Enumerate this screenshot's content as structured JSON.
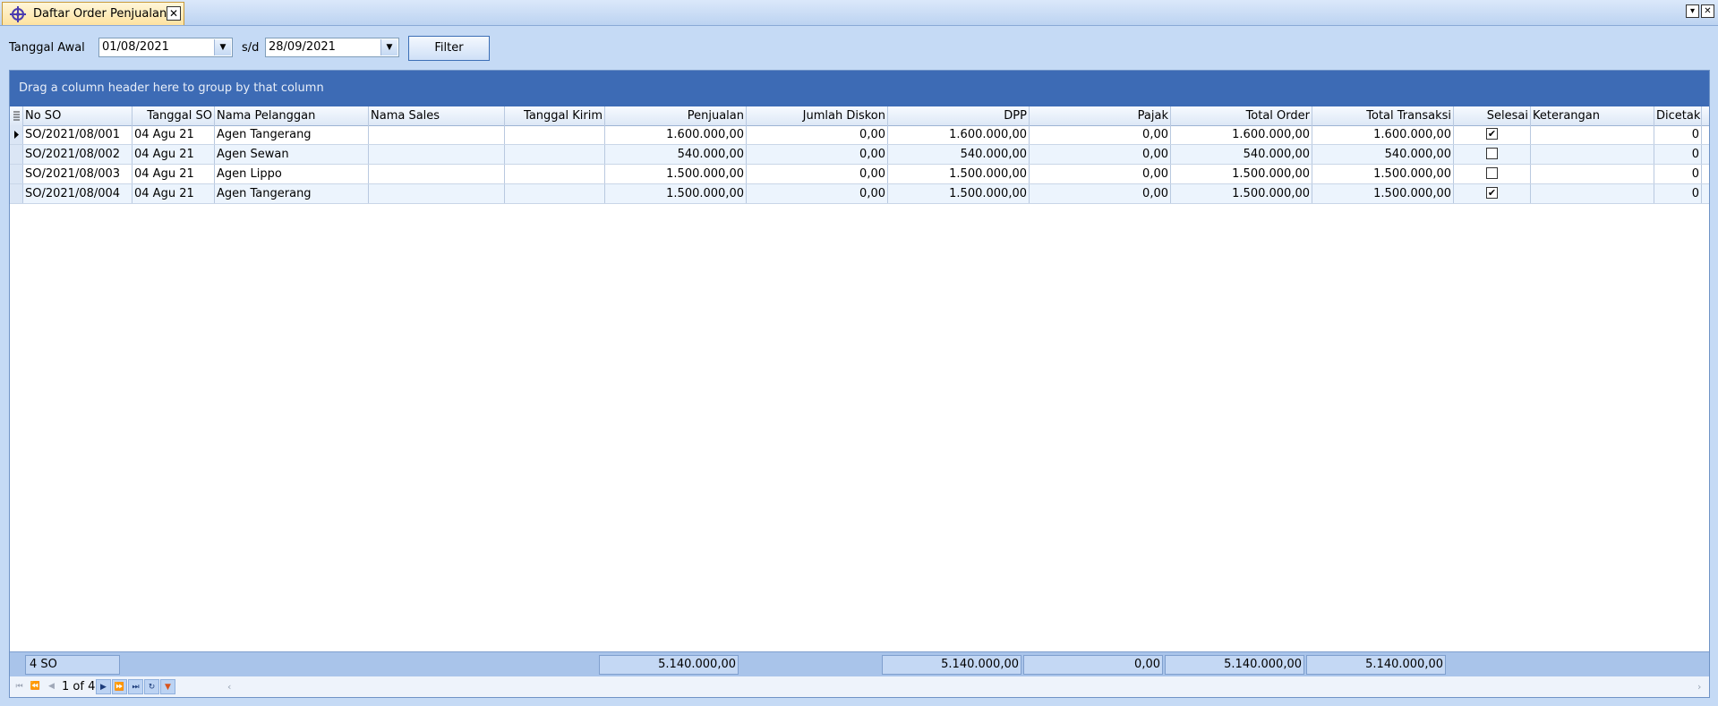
{
  "tab": {
    "title": "Daftar Order Penjualan",
    "close_glyph": "✕"
  },
  "window": {
    "menu_glyph": "▾",
    "close_glyph": "✕"
  },
  "filter": {
    "start_label": "Tanggal Awal",
    "start_value": "01/08/2021",
    "sep_label": "s/d",
    "end_value": "28/09/2021",
    "button_label": "Filter"
  },
  "grid": {
    "group_hint": "Drag a column header here to group by that column",
    "columns": [
      "No SO",
      "Tanggal SO",
      "Nama Pelanggan",
      "Nama Sales",
      "Tanggal Kirim",
      "Penjualan",
      "Jumlah Diskon",
      "DPP",
      "Pajak",
      "Total Order",
      "Total Transaksi",
      "Selesai",
      "Keterangan",
      "Dicetak"
    ],
    "rows": [
      {
        "no_so": "SO/2021/08/001",
        "tanggal": "04 Agu 21",
        "pelanggan": "Agen Tangerang",
        "sales": "",
        "kirim": "",
        "penjualan": "1.600.000,00",
        "diskon": "0,00",
        "dpp": "1.600.000,00",
        "pajak": "0,00",
        "total_order": "1.600.000,00",
        "total_transaksi": "1.600.000,00",
        "selesai": true,
        "keterangan": "",
        "dicetak": "0"
      },
      {
        "no_so": "SO/2021/08/002",
        "tanggal": "04 Agu 21",
        "pelanggan": "Agen Sewan",
        "sales": "",
        "kirim": "",
        "penjualan": "540.000,00",
        "diskon": "0,00",
        "dpp": "540.000,00",
        "pajak": "0,00",
        "total_order": "540.000,00",
        "total_transaksi": "540.000,00",
        "selesai": false,
        "keterangan": "",
        "dicetak": "0"
      },
      {
        "no_so": "SO/2021/08/003",
        "tanggal": "04 Agu 21",
        "pelanggan": "Agen Lippo",
        "sales": "",
        "kirim": "",
        "penjualan": "1.500.000,00",
        "diskon": "0,00",
        "dpp": "1.500.000,00",
        "pajak": "0,00",
        "total_order": "1.500.000,00",
        "total_transaksi": "1.500.000,00",
        "selesai": false,
        "keterangan": "",
        "dicetak": "0"
      },
      {
        "no_so": "SO/2021/08/004",
        "tanggal": "04 Agu 21",
        "pelanggan": "Agen Tangerang",
        "sales": "",
        "kirim": "",
        "penjualan": "1.500.000,00",
        "diskon": "0,00",
        "dpp": "1.500.000,00",
        "pajak": "0,00",
        "total_order": "1.500.000,00",
        "total_transaksi": "1.500.000,00",
        "selesai": true,
        "keterangan": "",
        "dicetak": "0"
      }
    ],
    "summary": {
      "count": "4 SO",
      "penjualan": "5.140.000,00",
      "dpp": "5.140.000,00",
      "pajak": "0,00",
      "total_order": "5.140.000,00",
      "total_transaksi": "5.140.000,00"
    },
    "navigator": {
      "record_text": "1 of 4"
    },
    "check_glyph": "✔"
  },
  "colors": {
    "group_panel": "#3d6bb5",
    "tab_active": "#fde2a0",
    "background": "#c5daf5"
  }
}
